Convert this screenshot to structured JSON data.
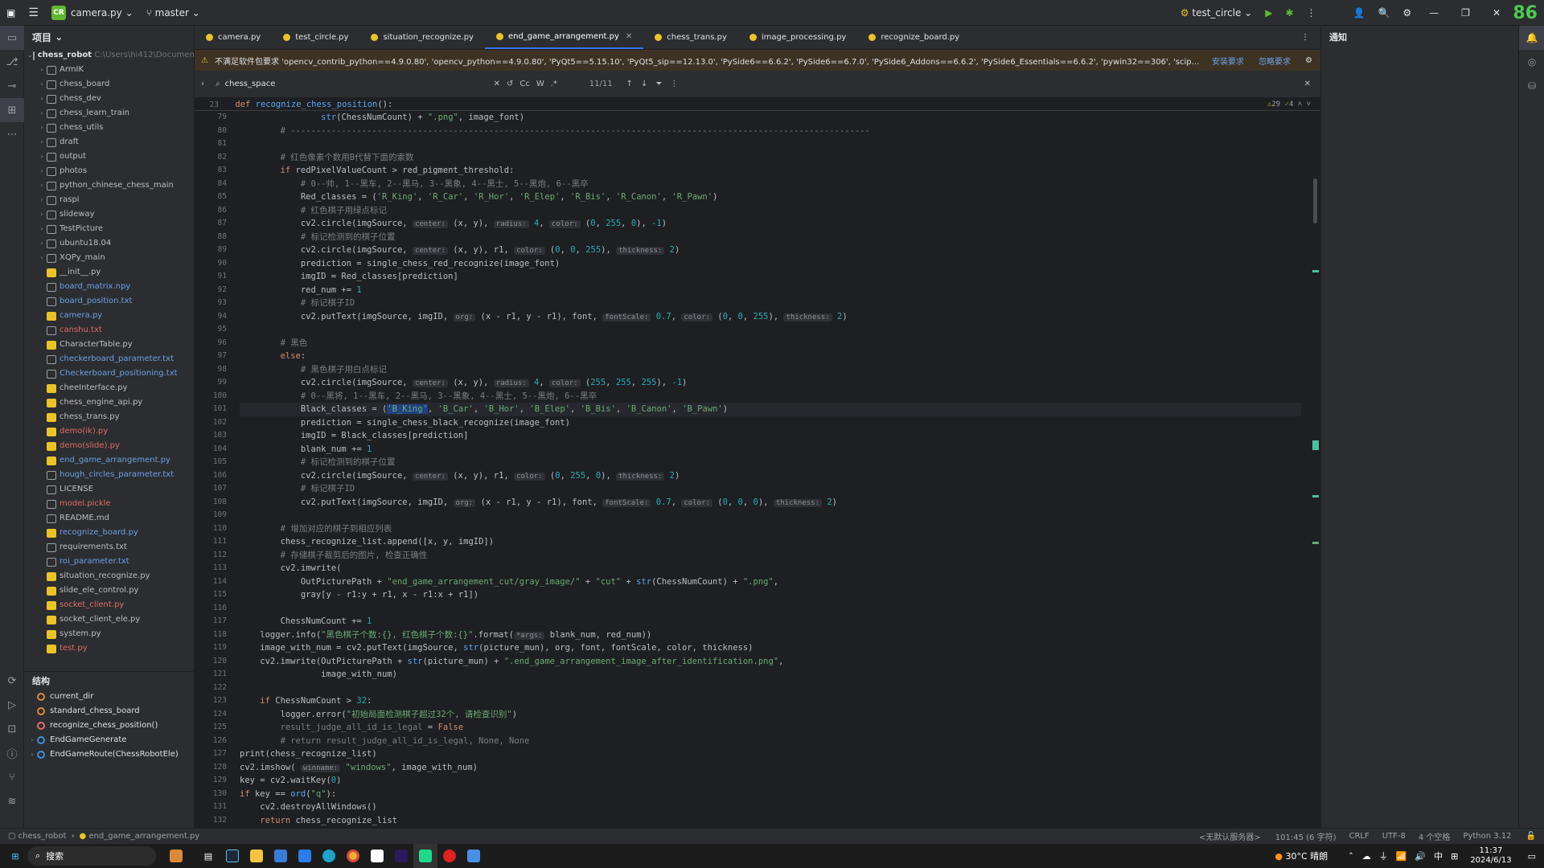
{
  "titlebar": {
    "project": "camera.py",
    "branch": "master",
    "run_config": "test_circle",
    "counter": "86",
    "proj_badge": "CR"
  },
  "tabs": [
    "camera.py",
    "test_circle.py",
    "situation_recognize.py",
    "end_game_arrangement.py",
    "chess_trans.py",
    "image_processing.py",
    "recognize_board.py"
  ],
  "active_tab": 3,
  "project_panel": {
    "title": "项目",
    "root": "chess_robot",
    "root_path": "C:\\Users\\hi412\\Documents...",
    "items": [
      {
        "name": "ArmIK",
        "type": "folder"
      },
      {
        "name": "chess_board",
        "type": "folder"
      },
      {
        "name": "chess_dev",
        "type": "folder"
      },
      {
        "name": "chess_learn_train",
        "type": "folder"
      },
      {
        "name": "chess_utils",
        "type": "folder"
      },
      {
        "name": "draft",
        "type": "folder"
      },
      {
        "name": "output",
        "type": "folder"
      },
      {
        "name": "photos",
        "type": "folder"
      },
      {
        "name": "python_chinese_chess_main",
        "type": "folder"
      },
      {
        "name": "raspi",
        "type": "folder"
      },
      {
        "name": "slideway",
        "type": "folder"
      },
      {
        "name": "TestPicture",
        "type": "folder"
      },
      {
        "name": "ubuntu18.04",
        "type": "folder"
      },
      {
        "name": "XQPy_main",
        "type": "folder"
      },
      {
        "name": "__init__.py",
        "type": "py"
      },
      {
        "name": "board_matrix.npy",
        "type": "file",
        "color": "blue"
      },
      {
        "name": "board_position.txt",
        "type": "file",
        "color": "blue"
      },
      {
        "name": "camera.py",
        "type": "py",
        "color": "blue"
      },
      {
        "name": "canshu.txt",
        "type": "file",
        "color": "red"
      },
      {
        "name": "CharacterTable.py",
        "type": "py"
      },
      {
        "name": "checkerboard_parameter.txt",
        "type": "file",
        "color": "blue"
      },
      {
        "name": "Checkerboard_positioning.txt",
        "type": "file",
        "color": "blue"
      },
      {
        "name": "cheeInterface.py",
        "type": "py"
      },
      {
        "name": "chess_engine_api.py",
        "type": "py"
      },
      {
        "name": "chess_trans.py",
        "type": "py"
      },
      {
        "name": "demo(ik).py",
        "type": "py",
        "color": "red"
      },
      {
        "name": "demo(slide).py",
        "type": "py",
        "color": "red"
      },
      {
        "name": "end_game_arrangement.py",
        "type": "py",
        "color": "blue"
      },
      {
        "name": "hough_circles_parameter.txt",
        "type": "file",
        "color": "blue"
      },
      {
        "name": "LICENSE",
        "type": "file"
      },
      {
        "name": "model.pickle",
        "type": "file",
        "color": "red"
      },
      {
        "name": "README.md",
        "type": "md"
      },
      {
        "name": "recognize_board.py",
        "type": "py",
        "color": "blue"
      },
      {
        "name": "requirements.txt",
        "type": "file"
      },
      {
        "name": "roi_parameter.txt",
        "type": "file",
        "color": "blue"
      },
      {
        "name": "situation_recognize.py",
        "type": "py"
      },
      {
        "name": "slide_ele_control.py",
        "type": "py"
      },
      {
        "name": "socket_client.py",
        "type": "py",
        "color": "red"
      },
      {
        "name": "socket_client_ele.py",
        "type": "py"
      },
      {
        "name": "system.py",
        "type": "py"
      },
      {
        "name": "test.py",
        "type": "py",
        "color": "red"
      }
    ]
  },
  "structure": {
    "title": "结构",
    "items": [
      {
        "name": "current_dir",
        "kind": "var"
      },
      {
        "name": "standard_chess_board",
        "kind": "var"
      },
      {
        "name": "recognize_chess_position()",
        "kind": "func"
      },
      {
        "name": "EndGameGenerate",
        "kind": "class"
      },
      {
        "name": "EndGameRoute(ChessRobotEle)",
        "kind": "class"
      }
    ]
  },
  "warning": {
    "text": "不满足软件包要求 'opencv_contrib_python==4.9.0.80', 'opencv_python==4.9.0.80', 'PyQt5==5.15.10', 'PyQt5_sip==12.13.0', 'PySide6==6.6.2', 'PySide6==6.7.0', 'PySide6_Addons==6.6.2', 'PySide6_Essentials==6.6.2', 'pywin32==306', 'scipy==1.13.0', 'tensorboard==2.16.2', 'torch==2.2.0...",
    "install": "安装要求",
    "ignore": "忽略要求"
  },
  "find": {
    "query": "chess_space",
    "count": "11/11",
    "opt_cc": "Cc",
    "opt_w": "W",
    "opt_re": ".*"
  },
  "editor": {
    "header_line": "23",
    "header_code": "def recognize_chess_position():",
    "warnings": "29",
    "checks": "4",
    "line_numbers": [
      "79",
      "80",
      "81",
      "82",
      "83",
      "84",
      "85",
      "86",
      "87",
      "88",
      "89",
      "90",
      "91",
      "92",
      "93",
      "94",
      "95",
      "96",
      "97",
      "98",
      "99",
      "100",
      "101",
      "102",
      "103",
      "104",
      "105",
      "106",
      "107",
      "108",
      "109",
      "110",
      "111",
      "112",
      "113",
      "114",
      "115",
      "116",
      "117",
      "118",
      "119",
      "120",
      "121",
      "122",
      "123",
      "124",
      "125",
      "126",
      "127",
      "128",
      "129",
      "130",
      "131",
      "132"
    ]
  },
  "notifications": {
    "title": "通知"
  },
  "statusbar": {
    "path_root": "chess_robot",
    "path_file": "end_game_arrangement.py",
    "server": "<无默认服务器>",
    "position": "101:45 (6 字符)",
    "eol": "CRLF",
    "encoding": "UTF-8",
    "indent": "4 个空格",
    "interpreter": "Python 3.12"
  },
  "taskbar": {
    "search": "搜索",
    "weather": "30°C 晴朗",
    "time": "11:37",
    "date": "2024/6/13",
    "ime": "中"
  },
  "colors": {
    "accent": "#3574f0",
    "warn_bg": "#3d3223",
    "badge": "#5fb832"
  }
}
